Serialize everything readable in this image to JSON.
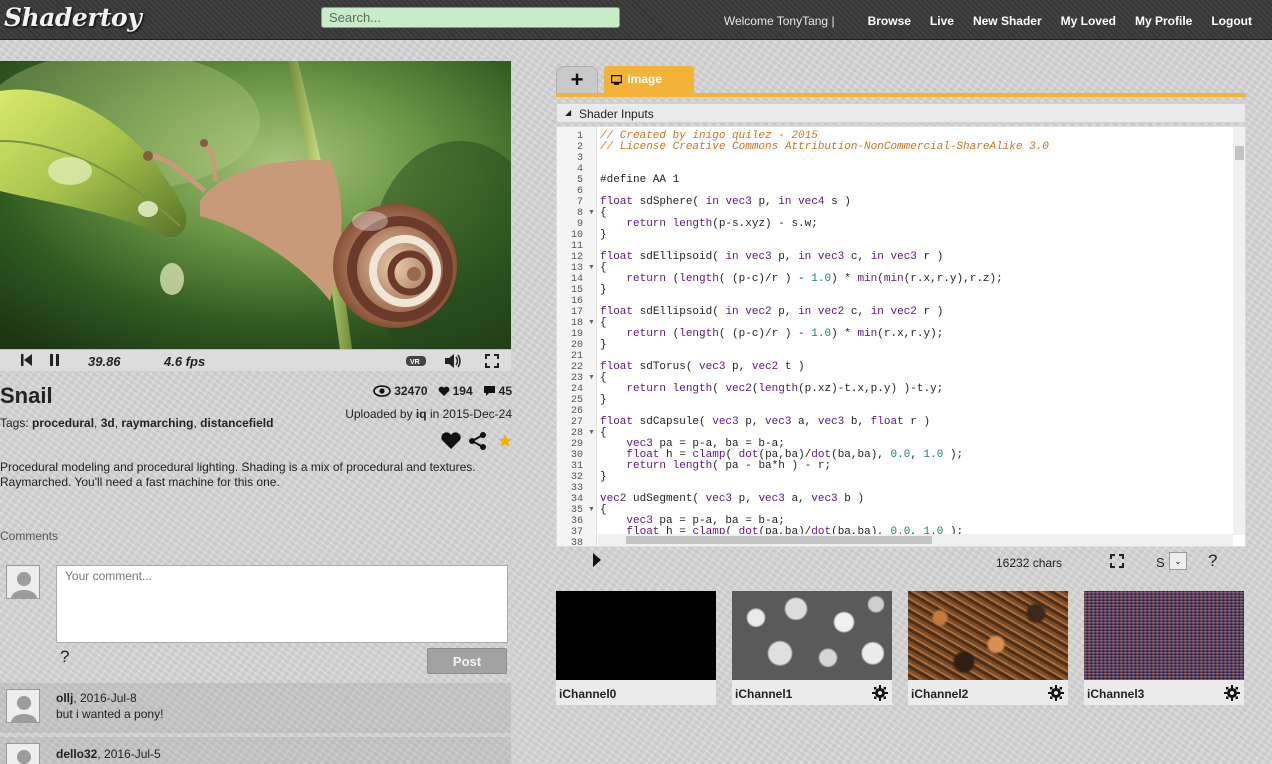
{
  "app": {
    "logo": "Shadertoy",
    "search_placeholder": "Search...",
    "welcome": "Welcome TonyTang |",
    "nav": [
      "Browse",
      "Live",
      "New Shader",
      "My Loved",
      "My Profile",
      "Logout"
    ]
  },
  "player": {
    "time": "39.86",
    "fps": "4.6 fps"
  },
  "shader": {
    "title": "Snail",
    "views": "32470",
    "likes": "194",
    "comments_count": "45",
    "uploaded_prefix": "Uploaded by",
    "author": "iq",
    "uploaded_suffix": "in 2015-Dec-24",
    "tags_label": "Tags:",
    "tags": [
      "procedural",
      "3d",
      "raymarching",
      "distancefield"
    ],
    "description": "Procedural modeling and procedural lighting. Shading is a mix of procedural and textures. Raymarched. You'll need a fast machine for this one."
  },
  "comments": {
    "label": "Comments",
    "placeholder": "Your comment...",
    "help": "?",
    "post": "Post",
    "items": [
      {
        "author": "ollj",
        "date": ", 2016-Jul-8",
        "text": "but i wanted a pony!"
      },
      {
        "author": "dello32",
        "date": ", 2016-Jul-5",
        "text": ""
      }
    ]
  },
  "editor": {
    "tab_add": "+",
    "tab_image": "Image",
    "inputs_label": "Shader Inputs",
    "chars": "16232 chars",
    "size_label": "S",
    "help": "?",
    "lines": [
      "// Created by inigo quilez - 2015",
      "// License Creative Commons Attribution-NonCommercial-ShareAlike 3.0",
      "",
      "",
      "#define AA 1",
      "",
      "float sdSphere( in vec3 p, in vec4 s )",
      "{",
      "    return length(p-s.xyz) - s.w;",
      "}",
      "",
      "float sdEllipsoid( in vec3 p, in vec3 c, in vec3 r )",
      "{",
      "    return (length( (p-c)/r ) - 1.0) * min(min(r.x,r.y),r.z);",
      "}",
      "",
      "float sdEllipsoid( in vec2 p, in vec2 c, in vec2 r )",
      "{",
      "    return (length( (p-c)/r ) - 1.0) * min(r.x,r.y);",
      "}",
      "",
      "float sdTorus( vec3 p, vec2 t )",
      "{",
      "    return length( vec2(length(p.xz)-t.x,p.y) )-t.y;",
      "}",
      "",
      "float sdCapsule( vec3 p, vec3 a, vec3 b, float r )",
      "{",
      "    vec3 pa = p-a, ba = b-a;",
      "    float h = clamp( dot(pa,ba)/dot(ba,ba), 0.0, 1.0 );",
      "    return length( pa - ba*h ) - r;",
      "}",
      "",
      "vec2 udSegment( vec3 p, vec3 a, vec3 b )",
      "{",
      "    vec3 pa = p-a, ba = b-a;",
      "    float h = clamp( dot(pa,ba)/dot(ba,ba), 0.0, 1.0 );",
      ""
    ]
  },
  "channels": [
    "iChannel0",
    "iChannel1",
    "iChannel2",
    "iChannel3"
  ],
  "colors": {
    "accent": "#f3b33a",
    "search_bg": "#c7ecc7",
    "topbar": "#3a3a3a"
  }
}
